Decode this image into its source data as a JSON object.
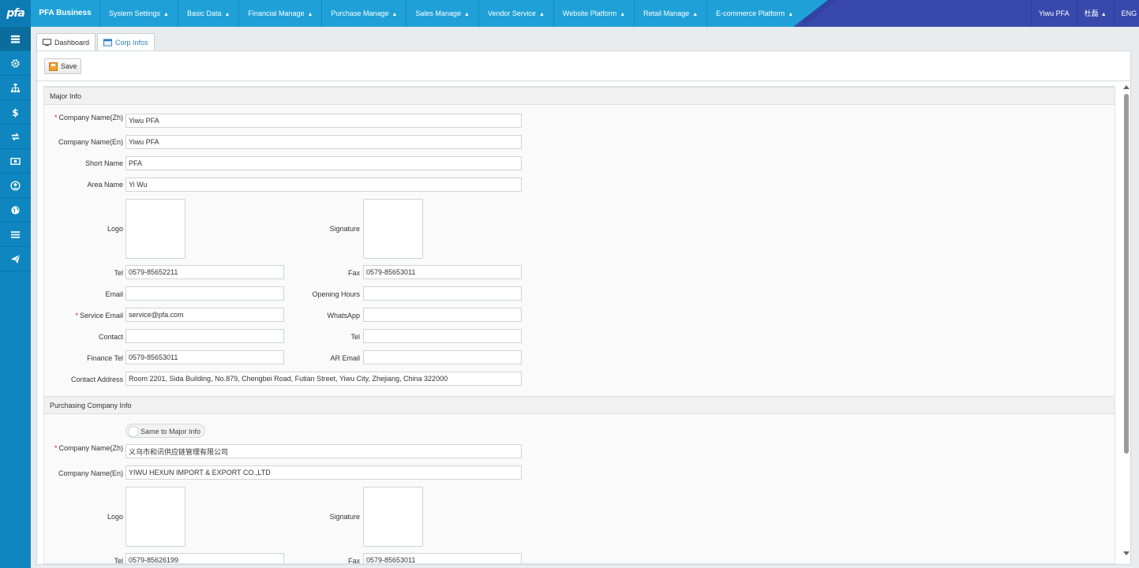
{
  "logo": "pfa",
  "brand": "PFA Business",
  "menu": [
    {
      "label": "System Settings"
    },
    {
      "label": "Basic Data"
    },
    {
      "label": "Financial Manage"
    },
    {
      "label": "Purchase Manage"
    },
    {
      "label": "Sales Manage"
    },
    {
      "label": "Vendor Service"
    },
    {
      "label": "Website Platform"
    },
    {
      "label": "Retail Manage"
    },
    {
      "label": "E-commerce Platform"
    }
  ],
  "user_menu": {
    "company": "Yiwu PFA",
    "user": "杜磊",
    "language": "ENG"
  },
  "sidebar_icons": [
    "list-icon",
    "gear-icon",
    "sitemap-icon",
    "dollar-icon",
    "exchange-icon",
    "money-icon",
    "user-circle-icon",
    "globe-icon",
    "bars-icon",
    "send-icon"
  ],
  "tabs": [
    {
      "label": "Dashboard",
      "icon": "monitor-icon"
    },
    {
      "label": "Corp Infos",
      "icon": "card-icon"
    }
  ],
  "toolbar": {
    "save_label": "Save"
  },
  "major": {
    "title": "Major Info",
    "company_name_zh_label": "Company Name(Zh)",
    "company_name_zh": "Yiwu PFA",
    "company_name_en_label": "Company Name(En)",
    "company_name_en": "Yiwu PFA",
    "short_name_label": "Short Name",
    "short_name": "PFA",
    "area_name_label": "Area Name",
    "area_name": "Yi Wu",
    "logo_label": "Logo",
    "signature_label": "Signature",
    "tel_label": "Tel",
    "tel": "0579-85652211",
    "fax_label": "Fax",
    "fax": "0579-85653011",
    "email_label": "Email",
    "email": "",
    "opening_hours_label": "Opening Hours",
    "opening_hours": "",
    "service_email_label": "Service Email",
    "service_email": "service@pfa.com",
    "whatsapp_label": "WhatsApp",
    "whatsapp": "",
    "contact_label": "Contact",
    "contact": "",
    "tel2_label": "Tel",
    "tel2": "",
    "finance_tel_label": "Finance Tel",
    "finance_tel": "0579-85653011",
    "ar_email_label": "AR Email",
    "ar_email": "",
    "contact_address_label": "Contact Address",
    "contact_address": "Room 2201, Sida Building, No.879, Chengbei Road, Futian Street, Yiwu City, Zhejiang, China 322000"
  },
  "purchasing": {
    "title": "Purchasing Company Info",
    "same_toggle_label": "Same to Major Info",
    "company_name_zh_label": "Company Name(Zh)",
    "company_name_zh": "义乌市和讯供应链管理有限公司",
    "company_name_en_label": "Company Name(En)",
    "company_name_en": "YIWU HEXUN IMPORT & EXPORT CO.,LTD",
    "logo_label": "Logo",
    "signature_label": "Signature",
    "tel_label": "Tel",
    "tel": "0579-85626199",
    "fax_label": "Fax",
    "fax": "0579-85653011"
  }
}
